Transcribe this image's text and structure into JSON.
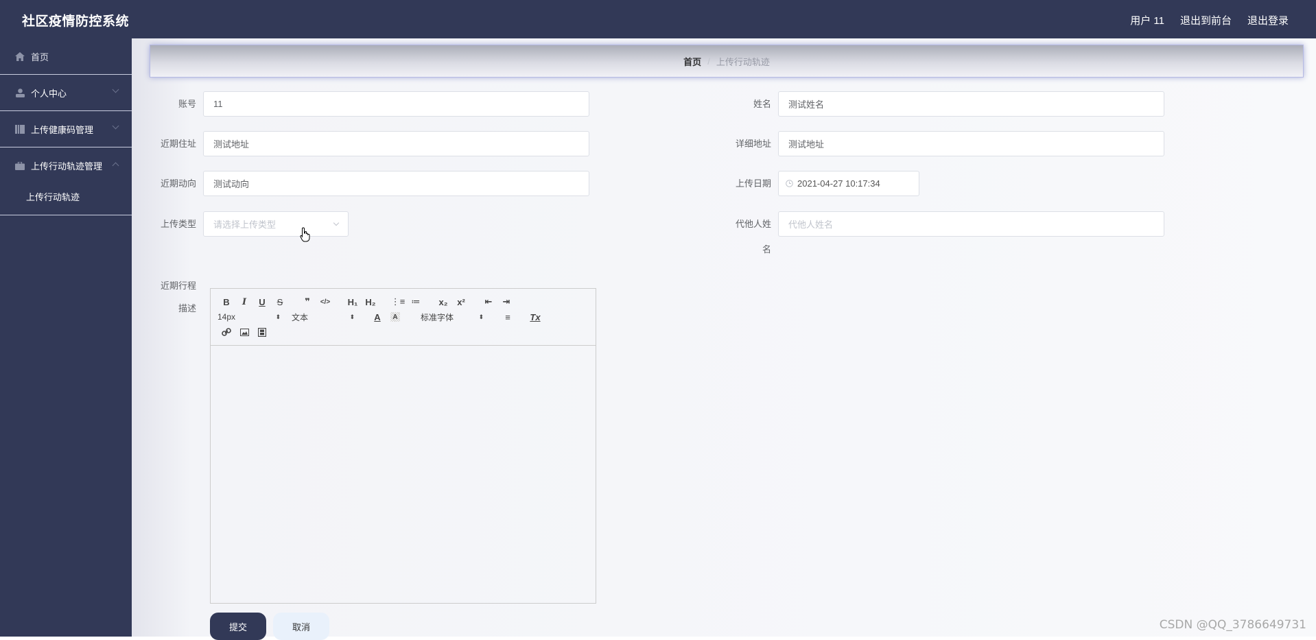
{
  "header": {
    "title": "社区疫情防控系统",
    "links": {
      "user": "用户 11",
      "front": "退出到前台",
      "logout": "退出登录"
    }
  },
  "sidebar": {
    "items": [
      {
        "label": "首页",
        "icon": "home-icon"
      },
      {
        "label": "个人中心",
        "icon": "user-icon",
        "expanded": false
      },
      {
        "label": "上传健康码管理",
        "icon": "book-icon",
        "expanded": false
      },
      {
        "label": "上传行动轨迹管理",
        "icon": "briefcase-icon",
        "expanded": true,
        "children": [
          {
            "label": "上传行动轨迹"
          }
        ]
      }
    ]
  },
  "breadcrumb": {
    "home": "首页",
    "separator": "/",
    "current": "上传行动轨迹"
  },
  "form": {
    "account": {
      "label": "账号",
      "value": "11"
    },
    "name": {
      "label": "姓名",
      "value": "测试姓名"
    },
    "recent_address": {
      "label": "近期住址",
      "value": "测试地址"
    },
    "detail_address": {
      "label": "详细地址",
      "value": "测试地址"
    },
    "recent_movement": {
      "label": "近期动向",
      "value": "测试动向"
    },
    "upload_date": {
      "label": "上传日期",
      "value": "2021-04-27 10:17:34"
    },
    "upload_type": {
      "label": "上传类型",
      "placeholder": "请选择上传类型"
    },
    "proxy_name": {
      "label": "代他人姓名",
      "placeholder": "代他人姓名"
    },
    "trip_desc": {
      "label": "近期行程描述"
    }
  },
  "editor": {
    "font_size": "14px",
    "header_select": "文本",
    "font_family": "标准字体",
    "buttons": {
      "bold": "B",
      "italic": "I",
      "underline": "U",
      "strike": "S",
      "quote": "❞",
      "code": "</>",
      "h1": "H₁",
      "h2": "H₂",
      "ol": "⋮≡",
      "ul": "≔",
      "sub": "x₂",
      "sup": "x²",
      "outdent": "⇤",
      "indent": "⇥",
      "color": "A",
      "bg": "A",
      "align": "≡",
      "clean": "Tx"
    }
  },
  "actions": {
    "submit": "提交",
    "cancel": "取消"
  },
  "watermark": "CSDN @QQ_3786649731"
}
